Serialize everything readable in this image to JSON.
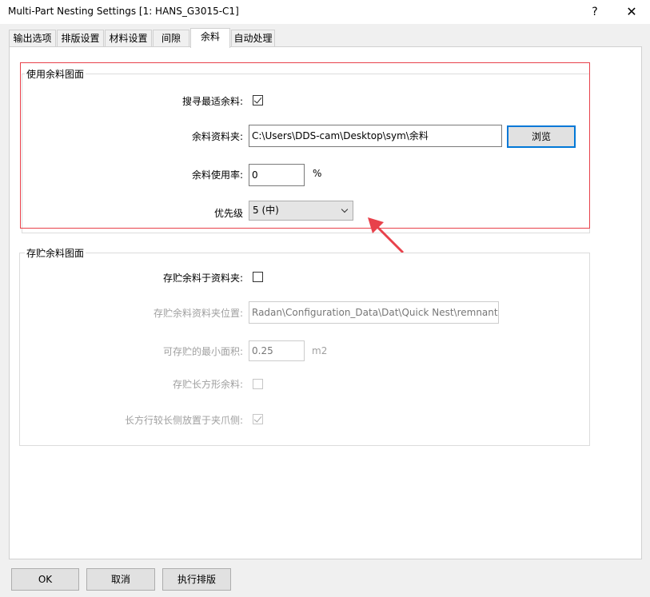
{
  "window": {
    "title": "Multi-Part Nesting Settings [1: HANS_G3015-C1]",
    "help_label": "?",
    "close_label": "✕"
  },
  "tabs": [
    {
      "label": "输出选项"
    },
    {
      "label": "排版设置"
    },
    {
      "label": "材料设置"
    },
    {
      "label": "间隙"
    },
    {
      "label": "余料",
      "active": true
    },
    {
      "label": "自动处理"
    }
  ],
  "use_remnant": {
    "group_title": "使用余料图面",
    "search_best_label": "搜寻最适余料:",
    "search_best_checked": true,
    "folder_label": "余料资料夹:",
    "folder_value": "C:\\Users\\DDS-cam\\Desktop\\sym\\余料",
    "browse_label": "浏览",
    "usage_label": "余料使用率:",
    "usage_value": "0",
    "usage_unit": "%",
    "priority_label": "优先级",
    "priority_value": "5 (中)"
  },
  "save_remnant": {
    "group_title": "存贮余料图面",
    "save_to_folder_label": "存贮余料于资料夹:",
    "save_to_folder_checked": false,
    "location_label": "存贮余料资料夹位置:",
    "location_value": "Radan\\Configuration_Data\\Dat\\Quick Nest\\remnants",
    "min_area_label": "可存贮的最小面积:",
    "min_area_value": "0.25",
    "min_area_unit": "m2",
    "rect_label": "存贮长方形余料:",
    "rect_checked": false,
    "long_side_label": "长方行较长侧放置于夹爪侧:",
    "long_side_checked": true
  },
  "footer": {
    "ok_label": "OK",
    "cancel_label": "取消",
    "run_label": "执行排版"
  },
  "colors": {
    "highlight": "#e8414b",
    "arrow": "#e8414b",
    "focus": "#0078d7"
  }
}
